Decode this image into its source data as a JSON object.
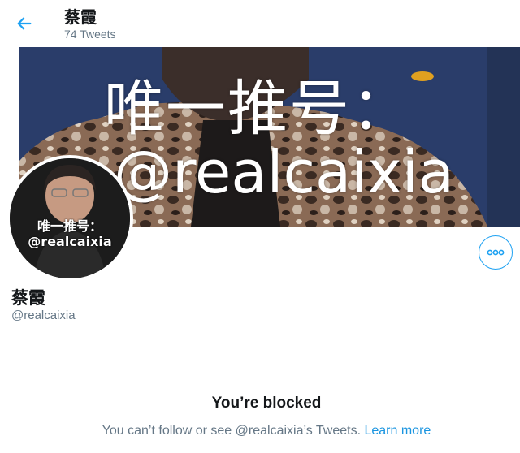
{
  "header": {
    "name": "蔡霞",
    "tweet_count": "74 Tweets"
  },
  "banner": {
    "line1": "唯一推号：",
    "line2": "@realcaixia"
  },
  "avatar": {
    "line1": "唯一推号：",
    "line2": "@realcaixia"
  },
  "profile": {
    "name": "蔡霞",
    "handle": "@realcaixia"
  },
  "blocked": {
    "title": "You’re blocked",
    "message": "You can’t follow or see @realcaixia’s Tweets.",
    "link": "Learn more"
  },
  "colors": {
    "accent": "#1da1f2",
    "text_primary": "#14171a",
    "text_secondary": "#657786"
  },
  "icons": {
    "back": "arrow-left-icon",
    "more": "more-horizontal-icon"
  }
}
